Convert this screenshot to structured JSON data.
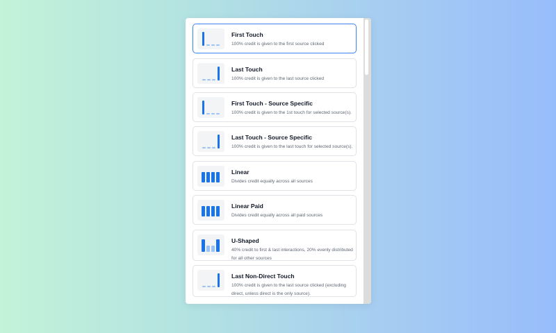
{
  "attribution_models": [
    {
      "title": "First Touch",
      "description": "100% credit is given to the first source clicked",
      "icon": "first-touch-icon",
      "selected": true
    },
    {
      "title": "Last Touch",
      "description": "100% credit is given to the last source clicked",
      "icon": "last-touch-icon"
    },
    {
      "title": "First Touch - Source Specific",
      "description": "100% credit is given to the 1st touch for selected source(s).",
      "icon": "first-touch-icon"
    },
    {
      "title": "Last Touch - Source Specific",
      "description": "100% credit is given to the last touch for selected source(s).",
      "icon": "last-touch-icon"
    },
    {
      "title": "Linear",
      "description": "Divides credit equally across all sources",
      "icon": "linear-icon"
    },
    {
      "title": "Linear Paid",
      "description": "Divides credit equally across all paid sources",
      "icon": "linear-icon"
    },
    {
      "title": "U-Shaped",
      "description": "40% credit to first & last interactions, 20% evenly distributed for all other sources",
      "icon": "u-shaped-icon"
    },
    {
      "title": "Last Non-Direct Touch",
      "description": "100% credit is given to the last source clicked (excluding direct, unless direct is the only source).",
      "icon": "last-touch-icon"
    }
  ],
  "colors": {
    "accent": "#1a73e8",
    "accent_light": "#9cc3f7",
    "selected_border": "#3b82f6"
  }
}
